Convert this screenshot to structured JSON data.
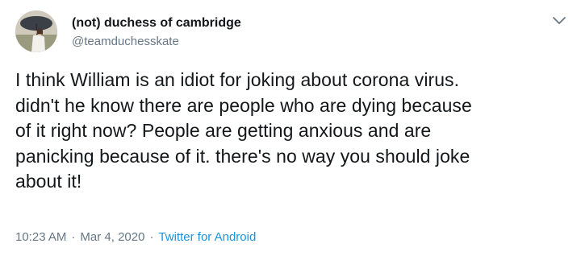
{
  "user": {
    "display_name": "(not) duchess of cambridge",
    "handle": "@teamduchesskate"
  },
  "tweet": {
    "text": "I think William is an idiot for joking about corona virus.\ndidn't he know there are people who are dying because\nof it right now? People are getting anxious and are\npanicking because of it. there's no way you should joke\nabout it!",
    "time": "10:23 AM",
    "separator": "·",
    "date": "Mar 4, 2020",
    "source": "Twitter for Android"
  },
  "icons": {
    "menu": "chevron-down-icon"
  },
  "colors": {
    "text": "#14171a",
    "secondary": "#657786",
    "link": "#1b95e0",
    "background": "#ffffff"
  }
}
